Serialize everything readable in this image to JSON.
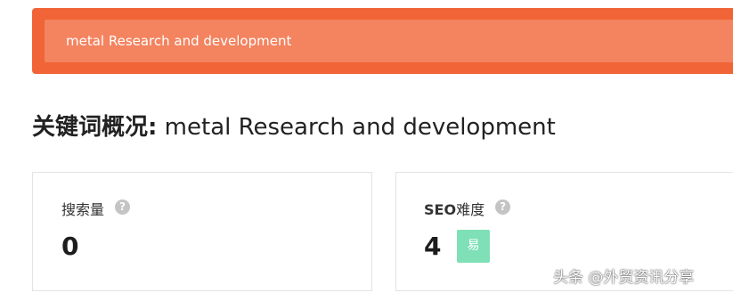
{
  "search": {
    "value": "metal Research and development"
  },
  "overview": {
    "title_prefix": "关键词概况:",
    "keyword": "metal Research and development"
  },
  "cards": {
    "search_volume": {
      "label": "搜索量",
      "help_icon": "help-circle-icon",
      "help_glyph": "?",
      "value": "0"
    },
    "seo_difficulty": {
      "label_strong": "SEO",
      "label_rest": "难度",
      "help_icon": "help-circle-icon",
      "help_glyph": "?",
      "value": "4",
      "badge": "易",
      "badge_color": "#7fe0b8"
    }
  },
  "watermark": {
    "text": "头条 @外贸资讯分享"
  },
  "colors": {
    "brand": "#f16437",
    "input_bg": "#f4835f"
  }
}
